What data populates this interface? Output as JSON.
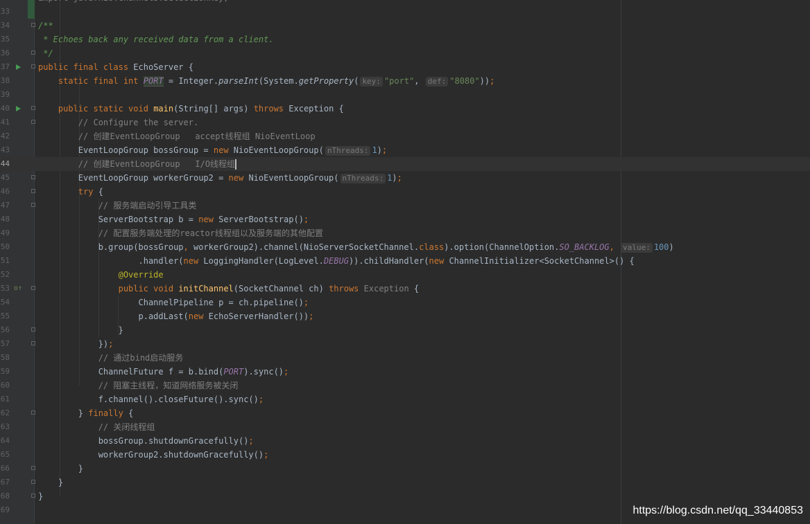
{
  "lines": [
    {
      "num": "32",
      "segs": [
        {
          "t": "import java.nio.channels.SelectionKey;",
          "c": "dim"
        }
      ]
    },
    {
      "num": "33",
      "segs": []
    },
    {
      "num": "34",
      "fold": true,
      "segs": [
        {
          "t": "/**",
          "c": "dc"
        }
      ]
    },
    {
      "num": "35",
      "segs": [
        {
          "t": " * Echoes back any received data from a client.",
          "c": "dc"
        }
      ]
    },
    {
      "num": "36",
      "fold": true,
      "segs": [
        {
          "t": " */",
          "c": "dc"
        }
      ]
    },
    {
      "num": "37",
      "run": true,
      "fold": true,
      "segs": [
        {
          "t": "public final class ",
          "c": "k"
        },
        {
          "t": "EchoServer {"
        }
      ]
    },
    {
      "num": "38",
      "segs": [
        {
          "t": "    "
        },
        {
          "t": "static final int ",
          "c": "k"
        },
        {
          "t": "PORT",
          "c": "st ph"
        },
        {
          "t": " = Integer."
        },
        {
          "t": "parseInt",
          "c": "sti"
        },
        {
          "t": "(System."
        },
        {
          "t": "getProperty",
          "c": "sti"
        },
        {
          "t": "("
        },
        {
          "t": "key:",
          "c": "hint"
        },
        {
          "t": "\"port\"",
          "c": "s"
        },
        {
          "t": ", "
        },
        {
          "t": "def:",
          "c": "hint"
        },
        {
          "t": "\"8080\"",
          "c": "s"
        },
        {
          "t": "))"
        },
        {
          "t": ";",
          "c": "k"
        }
      ]
    },
    {
      "num": "39",
      "segs": []
    },
    {
      "num": "40",
      "run": true,
      "fold": true,
      "segs": [
        {
          "t": "    "
        },
        {
          "t": "public static void ",
          "c": "k"
        },
        {
          "t": "main",
          "c": "f"
        },
        {
          "t": "(String[] args) "
        },
        {
          "t": "throws ",
          "c": "k"
        },
        {
          "t": "Exception {"
        }
      ]
    },
    {
      "num": "41",
      "fold": true,
      "segs": [
        {
          "t": "        "
        },
        {
          "t": "// Configure the server.",
          "c": "c"
        }
      ]
    },
    {
      "num": "42",
      "segs": [
        {
          "t": "        "
        },
        {
          "t": "// 创建EventLoopGroup   accept线程组 NioEventLoop",
          "c": "c"
        }
      ]
    },
    {
      "num": "43",
      "segs": [
        {
          "t": "        EventLoopGroup bossGroup = "
        },
        {
          "t": "new ",
          "c": "k"
        },
        {
          "t": "NioEventLoopGroup("
        },
        {
          "t": "nThreads:",
          "c": "hint"
        },
        {
          "t": "1",
          "c": "n"
        },
        {
          "t": ")"
        },
        {
          "t": ";",
          "c": "k"
        }
      ]
    },
    {
      "num": "44",
      "current": true,
      "segs": [
        {
          "t": "        "
        },
        {
          "t": "// 创建EventLoopGroup   I/O线程组",
          "c": "c"
        },
        {
          "t": "",
          "c": "caret"
        }
      ]
    },
    {
      "num": "45",
      "fold": true,
      "segs": [
        {
          "t": "        EventLoopGroup workerGroup2 = "
        },
        {
          "t": "new ",
          "c": "k"
        },
        {
          "t": "NioEventLoopGroup("
        },
        {
          "t": "nThreads:",
          "c": "hint"
        },
        {
          "t": "1",
          "c": "n"
        },
        {
          "t": ")"
        },
        {
          "t": ";",
          "c": "k"
        }
      ]
    },
    {
      "num": "46",
      "fold": true,
      "segs": [
        {
          "t": "        "
        },
        {
          "t": "try ",
          "c": "k"
        },
        {
          "t": "{"
        }
      ]
    },
    {
      "num": "47",
      "fold": true,
      "segs": [
        {
          "t": "            "
        },
        {
          "t": "// 服务端启动引导工具类",
          "c": "c"
        }
      ]
    },
    {
      "num": "48",
      "segs": [
        {
          "t": "            ServerBootstrap b = "
        },
        {
          "t": "new ",
          "c": "k"
        },
        {
          "t": "ServerBootstrap()"
        },
        {
          "t": ";",
          "c": "k"
        }
      ]
    },
    {
      "num": "49",
      "segs": [
        {
          "t": "            "
        },
        {
          "t": "// 配置服务端处理的reactor线程组以及服务端的其他配置",
          "c": "c"
        }
      ]
    },
    {
      "num": "50",
      "segs": [
        {
          "t": "            b.group(bossGroup"
        },
        {
          "t": ", ",
          "c": "k"
        },
        {
          "t": "workerGroup2).channel(NioServerSocketChannel."
        },
        {
          "t": "class",
          "c": "k"
        },
        {
          "t": ").option(ChannelOption."
        },
        {
          "t": "SO_BACKLOG",
          "c": "st"
        },
        {
          "t": ", ",
          "c": "k"
        },
        {
          "t": "value:",
          "c": "hint"
        },
        {
          "t": "100",
          "c": "n"
        },
        {
          "t": ")"
        }
      ]
    },
    {
      "num": "51",
      "segs": [
        {
          "t": "                    .handler("
        },
        {
          "t": "new ",
          "c": "k"
        },
        {
          "t": "LoggingHandler(LogLevel."
        },
        {
          "t": "DEBUG",
          "c": "st"
        },
        {
          "t": ")).childHandler("
        },
        {
          "t": "new ",
          "c": "k"
        },
        {
          "t": "ChannelInitializer<SocketChannel>() {"
        }
      ]
    },
    {
      "num": "52",
      "segs": [
        {
          "t": "                "
        },
        {
          "t": "@Override",
          "c": "a"
        }
      ]
    },
    {
      "num": "53",
      "ovr": true,
      "fold": true,
      "segs": [
        {
          "t": "                "
        },
        {
          "t": "public void ",
          "c": "k"
        },
        {
          "t": "initChannel",
          "c": "f"
        },
        {
          "t": "(SocketChannel ch) "
        },
        {
          "t": "throws ",
          "c": "k"
        },
        {
          "t": "Exception",
          "c": "dim"
        },
        {
          "t": " {"
        }
      ]
    },
    {
      "num": "54",
      "segs": [
        {
          "t": "                    ChannelPipeline p = ch.pipeline()"
        },
        {
          "t": ";",
          "c": "k"
        }
      ]
    },
    {
      "num": "55",
      "segs": [
        {
          "t": "                    p.addLast("
        },
        {
          "t": "new ",
          "c": "k"
        },
        {
          "t": "EchoServerHandler())"
        },
        {
          "t": ";",
          "c": "k"
        }
      ]
    },
    {
      "num": "56",
      "fold": true,
      "segs": [
        {
          "t": "                }"
        }
      ]
    },
    {
      "num": "57",
      "fold": true,
      "segs": [
        {
          "t": "            })"
        },
        {
          "t": ";",
          "c": "k"
        }
      ]
    },
    {
      "num": "58",
      "segs": [
        {
          "t": "            "
        },
        {
          "t": "// 通过bind启动服务",
          "c": "c"
        }
      ]
    },
    {
      "num": "59",
      "segs": [
        {
          "t": "            ChannelFuture f = b.bind("
        },
        {
          "t": "PORT",
          "c": "st"
        },
        {
          "t": ").sync()"
        },
        {
          "t": ";",
          "c": "k"
        }
      ]
    },
    {
      "num": "60",
      "segs": [
        {
          "t": "            "
        },
        {
          "t": "// 阻塞主线程，知道网络服务被关闭",
          "c": "c"
        }
      ]
    },
    {
      "num": "61",
      "segs": [
        {
          "t": "            f.channel().closeFuture().sync()"
        },
        {
          "t": ";",
          "c": "k"
        }
      ]
    },
    {
      "num": "62",
      "fold": true,
      "segs": [
        {
          "t": "        } "
        },
        {
          "t": "finally ",
          "c": "k"
        },
        {
          "t": "{"
        }
      ]
    },
    {
      "num": "63",
      "segs": [
        {
          "t": "            "
        },
        {
          "t": "// 关闭线程组",
          "c": "c"
        }
      ]
    },
    {
      "num": "64",
      "segs": [
        {
          "t": "            bossGroup.shutdownGracefully()"
        },
        {
          "t": ";",
          "c": "k"
        }
      ]
    },
    {
      "num": "65",
      "segs": [
        {
          "t": "            workerGroup2.shutdownGracefully()"
        },
        {
          "t": ";",
          "c": "k"
        }
      ]
    },
    {
      "num": "66",
      "fold": true,
      "segs": [
        {
          "t": "        }"
        }
      ]
    },
    {
      "num": "67",
      "fold": true,
      "segs": [
        {
          "t": "    }"
        }
      ]
    },
    {
      "num": "68",
      "fold": true,
      "segs": [
        {
          "t": "}"
        }
      ]
    },
    {
      "num": "69",
      "segs": []
    }
  ],
  "watermark": "https://blog.csdn.net/qq_33440853",
  "colors": {
    "background": "#2b2b2b",
    "keyword": "#cc7832",
    "string": "#6a8759",
    "number": "#6897bb",
    "comment": "#808080",
    "static_field": "#9876aa",
    "method_decl": "#ffc66d",
    "annotation": "#bbb529",
    "run_icon": "#499c54"
  }
}
